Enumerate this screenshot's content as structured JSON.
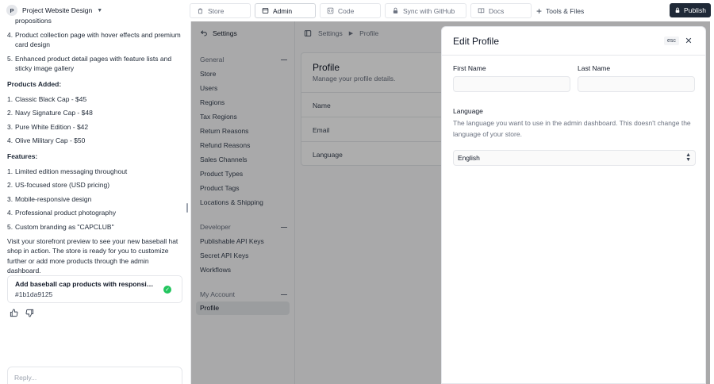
{
  "project": {
    "avatar": "P",
    "name": "Project Website Design"
  },
  "chat": {
    "top_items": [
      {
        "n": "",
        "text": "propositions"
      },
      {
        "n": "4.",
        "text": "Product collection page with hover effects and premium card design"
      },
      {
        "n": "5.",
        "text": "Enhanced product detail pages with feature lists and sticky image gallery"
      }
    ],
    "products_heading": "Products Added:",
    "products": [
      {
        "n": "1.",
        "text": "Classic Black Cap - $45"
      },
      {
        "n": "2.",
        "text": "Navy Signature Cap - $48"
      },
      {
        "n": "3.",
        "text": "Pure White Edition - $42"
      },
      {
        "n": "4.",
        "text": "Olive Military Cap - $50"
      }
    ],
    "features_heading": "Features:",
    "features": [
      {
        "n": "1.",
        "text": "Limited edition messaging throughout"
      },
      {
        "n": "2.",
        "text": "US-focused store (USD pricing)"
      },
      {
        "n": "3.",
        "text": "Mobile-responsive design"
      },
      {
        "n": "4.",
        "text": "Professional product photography"
      },
      {
        "n": "5.",
        "text": "Custom branding as \"CAPCLUB\""
      }
    ],
    "closing": "Visit your storefront preview to see your new baseball hat shop in action. The store is ready for you to customize further or add more products through the admin dashboard.",
    "commit": {
      "title": "Add baseball cap products with responsive g...",
      "hash": "#1b1da9125"
    },
    "reply_placeholder": "Reply..."
  },
  "tabs": [
    {
      "label": "Store",
      "icon": "store-icon",
      "active": false
    },
    {
      "label": "Admin",
      "icon": "admin-icon",
      "active": true
    },
    {
      "label": "Code",
      "icon": "code-icon",
      "active": false
    },
    {
      "label": "Sync with GitHub",
      "icon": "lock-icon",
      "active": false
    },
    {
      "label": "Docs",
      "icon": "book-icon",
      "active": false
    }
  ],
  "tools_label": "Tools & Files",
  "publish_label": "Publish",
  "admin": {
    "header": "Settings",
    "sections": [
      {
        "title": "General",
        "items": [
          "Store",
          "Users",
          "Regions",
          "Tax Regions",
          "Return Reasons",
          "Refund Reasons",
          "Sales Channels",
          "Product Types",
          "Product Tags",
          "Locations & Shipping"
        ]
      },
      {
        "title": "Developer",
        "items": [
          "Publishable API Keys",
          "Secret API Keys",
          "Workflows"
        ]
      },
      {
        "title": "My Account",
        "items": [
          "Profile"
        ]
      }
    ],
    "breadcrumb": [
      "Settings",
      "Profile"
    ],
    "card": {
      "title": "Profile",
      "subtitle": "Manage your profile details.",
      "rows": [
        "Name",
        "Email",
        "Language"
      ]
    }
  },
  "drawer": {
    "title": "Edit Profile",
    "esc_label": "esc",
    "first_name_label": "First Name",
    "first_name_value": "",
    "last_name_label": "Last Name",
    "last_name_value": "",
    "language_label": "Language",
    "language_help": "The language you want to use in the admin dashboard. This doesn't change the language of your store.",
    "language_value": "English"
  },
  "colors": {
    "publish_bg": "#1f2937",
    "check": "#22c55e",
    "overlay": "rgba(0,0,0,0.32)"
  }
}
